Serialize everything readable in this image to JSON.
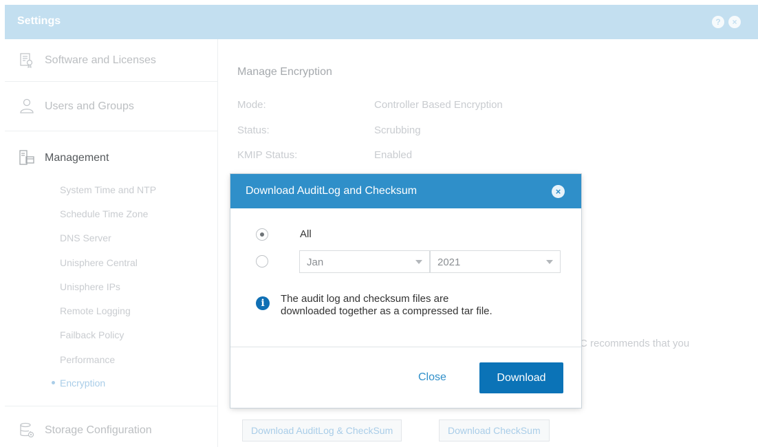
{
  "window": {
    "title": "Settings",
    "help_glyph": "?",
    "close_glyph": "×"
  },
  "sidebar": {
    "sections": [
      {
        "label": "Software and Licenses",
        "icon": "license-icon"
      },
      {
        "label": "Users and Groups",
        "icon": "user-icon"
      },
      {
        "label": "Management",
        "icon": "management-icon"
      },
      {
        "label": "Storage Configuration",
        "icon": "storage-config-icon"
      }
    ],
    "management_items": [
      "System Time and NTP",
      "Schedule Time Zone",
      "DNS Server",
      "Unisphere Central",
      "Unisphere IPs",
      "Remote Logging",
      "Failback Policy",
      "Performance",
      "Encryption"
    ],
    "selected_item": "Encryption"
  },
  "content": {
    "heading": "Manage Encryption",
    "fields": [
      {
        "label": "Mode:",
        "value": "Controller Based Encryption"
      },
      {
        "label": "Status:",
        "value": "Scrubbing"
      },
      {
        "label": "KMIP Status:",
        "value": "Enabled"
      }
    ],
    "trailing_text": "C recommends that you",
    "buttons": {
      "download_auditlog": "Download AuditLog & CheckSum",
      "download_checksum": "Download CheckSum"
    }
  },
  "dialog": {
    "title": "Download AuditLog and Checksum",
    "close_glyph": "×",
    "option_all": "All",
    "month_select": "Jan",
    "year_select": "2021",
    "info_glyph": "i",
    "info_lines": [
      "The audit log and checksum files are",
      "downloaded together as a compressed tar file."
    ],
    "close_label": "Close",
    "download_label": "Download",
    "selected_option": "all"
  },
  "colors": {
    "accent": "#2f8fc9",
    "primary_button": "#0b73b7",
    "titlebar": "#c3dff0"
  }
}
